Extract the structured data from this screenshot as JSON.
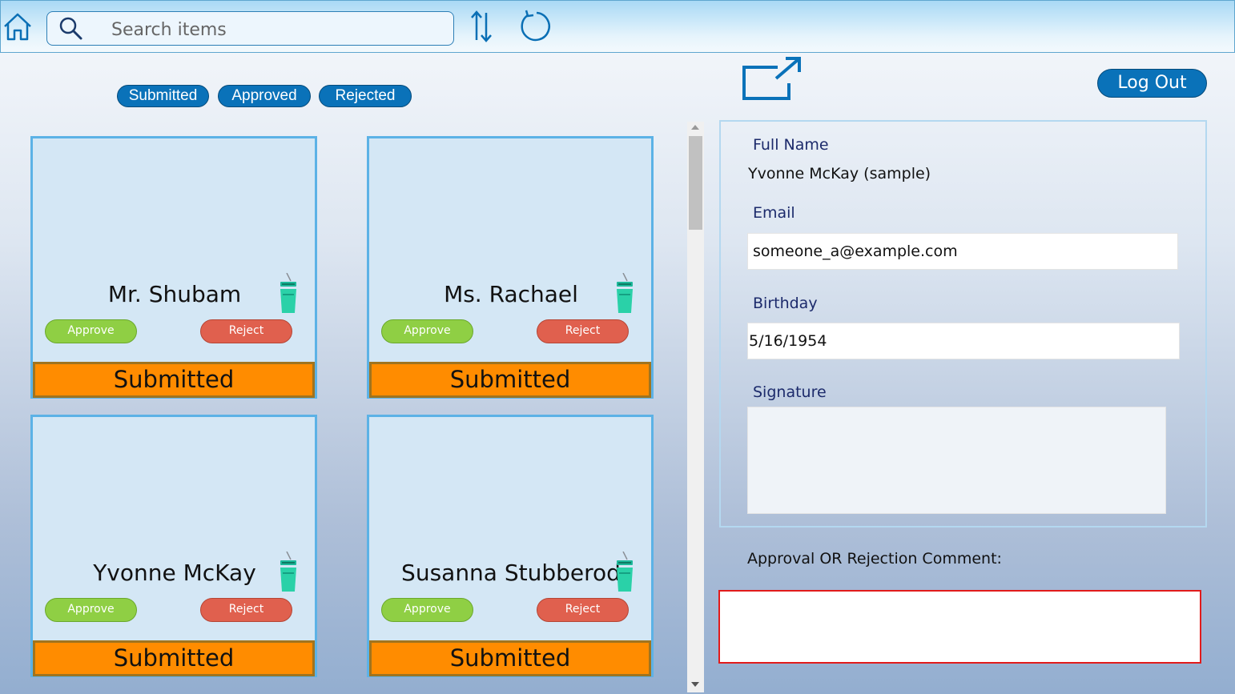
{
  "toolbar": {
    "search_placeholder": "Search items",
    "home_icon": "home-icon",
    "search_icon": "search-icon",
    "sort_icon": "sort-icon",
    "refresh_icon": "refresh-icon"
  },
  "filters": {
    "submitted": "Submitted",
    "approved": "Approved",
    "rejected": "Rejected"
  },
  "header": {
    "logout_label": "Log Out",
    "open_icon": "open-external-icon"
  },
  "cards": [
    {
      "name": "Mr. Shubam",
      "approve": "Approve",
      "reject": "Reject",
      "status": "Submitted"
    },
    {
      "name": "Ms. Rachael",
      "approve": "Approve",
      "reject": "Reject",
      "status": "Submitted"
    },
    {
      "name": "Yvonne McKay",
      "approve": "Approve",
      "reject": "Reject",
      "status": "Submitted"
    },
    {
      "name": "Susanna Stubberod",
      "approve": "Approve",
      "reject": "Reject",
      "status": "Submitted"
    }
  ],
  "form": {
    "full_name_label": "Full Name",
    "full_name_value": "Yvonne McKay (sample)",
    "email_label": "Email",
    "email_value": "someone_a@example.com",
    "birthday_label": "Birthday",
    "birthday_value": "5/16/1954",
    "signature_label": "Signature"
  },
  "comment": {
    "label": "Approval OR Rejection Comment:",
    "value": ""
  },
  "colors": {
    "primary_button": "#0a72b9",
    "approve": "#8fcf44",
    "reject": "#e0604e",
    "status_submitted": "#ff8c00",
    "card_border": "#5cb2e6",
    "comment_border": "#e21b1b"
  }
}
